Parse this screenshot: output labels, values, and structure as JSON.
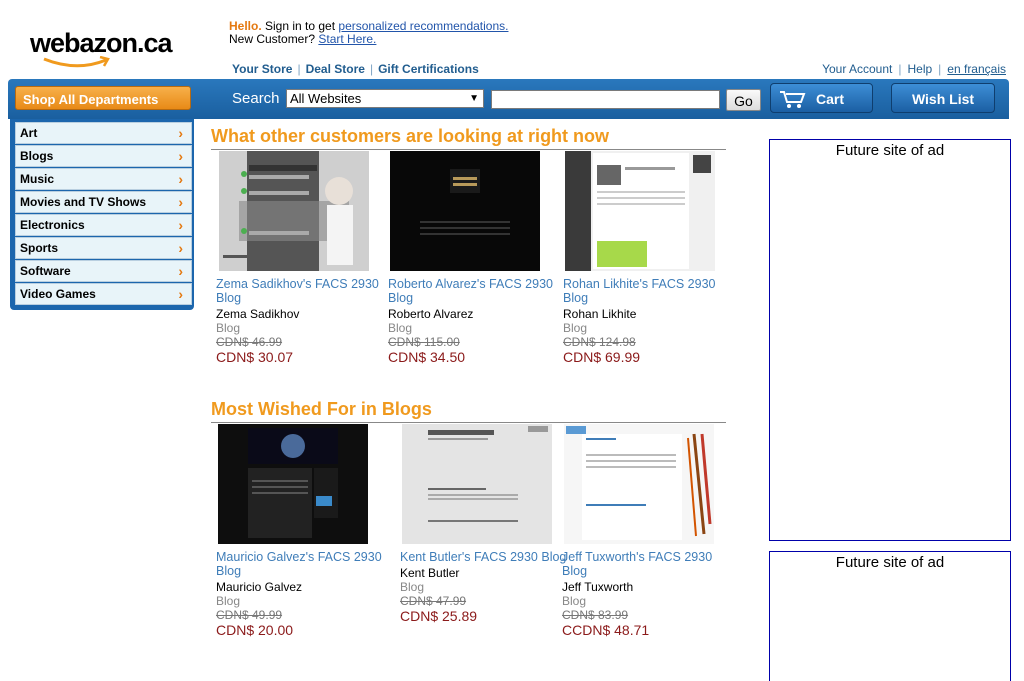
{
  "logo": {
    "text": "webazon.ca"
  },
  "greeting": {
    "hello": "Hello.",
    "signin_text": " Sign in to get ",
    "signin_link": "personalized recommendations.",
    "new_customer": "New Customer? ",
    "start_link": "Start Here."
  },
  "topnav": [
    "Your Store",
    "Deal Store",
    "Gift Certifications"
  ],
  "account_nav": [
    "Your Account",
    "Help",
    "en français"
  ],
  "shop_all": "Shop All Departments",
  "search": {
    "label": "Search",
    "category": "All Websites",
    "value": "",
    "go": "Go"
  },
  "cart_label": "Cart",
  "wish_label": "Wish List",
  "departments": [
    "Art",
    "Blogs",
    "Music",
    "Movies and TV Shows",
    "Electronics",
    "Sports",
    "Software",
    "Video Games"
  ],
  "sections": [
    {
      "title": "What other customers are looking at right now",
      "products": [
        {
          "title": "Zema Sadikhov's FACS 2930 Blog",
          "author": "Zema Sadikhov",
          "type": "Blog",
          "list_price": "CDN$ 46.99",
          "price": "CDN$ 30.07",
          "thumb_caption": "Podolski's Turf"
        },
        {
          "title": "Roberto Alvarez's FACS 2930 Blog",
          "author": "Roberto Alvarez",
          "type": "Blog",
          "list_price": "CDN$ 115.00",
          "price": "CDN$ 34.50",
          "thumb_caption": "RAW BEEF"
        },
        {
          "title": "Rohan Likhite's FACS 2930 Blog",
          "author": "Rohan Likhite",
          "type": "Blog",
          "list_price": "CDN$ 124.98",
          "price": "CDN$ 69.99",
          "thumb_caption": "Crowdsourcing"
        }
      ]
    },
    {
      "title": "Most Wished For in Blogs",
      "products": [
        {
          "title": "Mauricio Galvez's FACS 2930 Blog",
          "author": "Mauricio Galvez",
          "type": "Blog",
          "list_price": "CDN$ 49.99",
          "price": "CDN$ 20.00",
          "thumb_caption": ""
        },
        {
          "title": "Kent Butler's FACS 2930 Blog",
          "author": "Kent Butler",
          "type": "Blog",
          "list_price": "CDN$ 47.99",
          "price": "CDN$ 25.89",
          "thumb_caption": "Kent.D.Butler/Facs 2930"
        },
        {
          "title": "Jeff Tuxworth's FACS 2930 Blog",
          "author": "Jeff Tuxworth",
          "type": "Blog",
          "list_price": "CDN$ 83.99",
          "price": "CCDN$ 48.71",
          "thumb_caption": ""
        }
      ]
    }
  ],
  "ads": [
    "Future site of ad",
    "Future site of ad"
  ],
  "colors": {
    "accent": "#f09a1e",
    "nav_blue": "#1c66ad",
    "price": "#8b1a1a",
    "link": "#3f7db8"
  }
}
